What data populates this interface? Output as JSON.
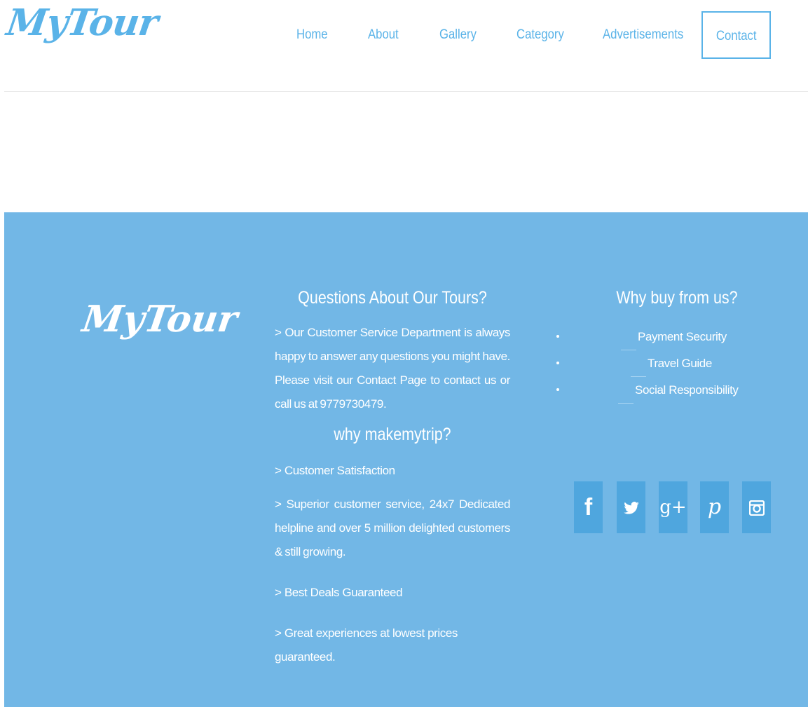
{
  "brand": {
    "name": "MyTour"
  },
  "nav": {
    "home": "Home",
    "about": "About",
    "gallery": "Gallery",
    "category": "Category",
    "advertisements": "Advertisements",
    "contact": "Contact"
  },
  "footer": {
    "questions": {
      "heading": "Questions About Our Tours?",
      "body": ">  Our Customer Service Department is always happy to answer any questions you might have. Please visit our Contact Page to contact us or call us at 9779730479."
    },
    "why_makemytrip": {
      "heading": "why makemytrip?",
      "items": [
        "> Customer Satisfaction",
        "> Superior customer service, 24x7 Dedicated helpline and over 5 million delighted customers & still growing.",
        "> Best Deals Guaranteed",
        "> Great experiences at lowest prices guaranteed."
      ]
    },
    "why_buy": {
      "heading": "Why buy from us?",
      "items": [
        "Payment Security",
        "Travel Guide",
        "Social Responsibility"
      ]
    },
    "social": [
      "f",
      "t",
      "g+",
      "p",
      "o"
    ]
  },
  "colors": {
    "brand": "#5ab3e8",
    "footer_bg": "#72b7e6",
    "social_bg": "#4fa6de"
  }
}
